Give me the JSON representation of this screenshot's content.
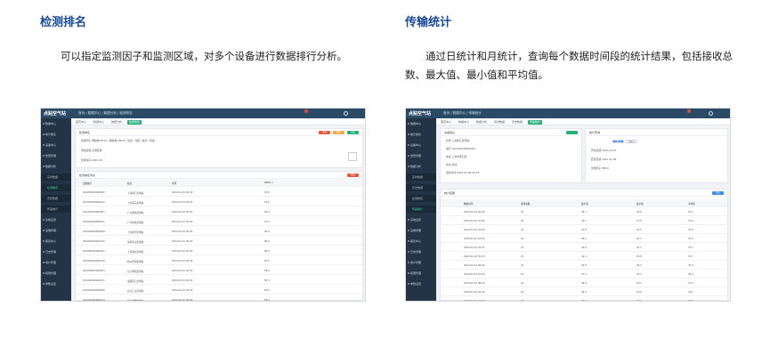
{
  "left": {
    "title": "检测排名",
    "description": "可以指定监测因子和监测区域，对多个设备进行数据排行分析。",
    "shot": {
      "logo": "点贴空气站",
      "breadcrumb": "首页 / 数据中心 / 数据分析 / 检测排名",
      "tabs": [
        "首页中心",
        "数据中心",
        "数据分析",
        "检测排名"
      ],
      "sidebar": [
        "数据中心",
        "统计报表",
        "设备中心",
        "告警管理",
        "数据分析",
        "实时数据",
        "检测排名",
        "历史数据",
        "传输统计",
        "系统设置",
        "运维管理",
        "报表中心",
        "日志管理",
        "用户管理",
        "权限管理",
        "参数设置"
      ],
      "filter_title": "检测排名",
      "filter_rows": [
        "监测因子  颗粒物 PM10 / 颗粒物 PM2.5 / 温度 / 湿度 / 噪声 / 风速",
        "所属区域  全部区域",
        "监测时间  2022-05"
      ],
      "buttons": [
        {
          "label": "查询",
          "color": "#e9573f"
        },
        {
          "label": "重置",
          "color": "#f0ad4e"
        },
        {
          "label": "导出",
          "color": "#27b07a"
        }
      ],
      "table_title": "检测排名列表",
      "table_btn": "导出",
      "columns": [
        "设备编号",
        "站点",
        "时间",
        "PM10 ↓"
      ],
      "rows": [
        [
          "202206040060003",
          "上海徐汇监测站",
          "2022-02-01 00:00",
          "95.0"
        ],
        [
          "202206040060012",
          "上海浦东监测站",
          "2022-02-01 00:00",
          "93.0"
        ],
        [
          "202206040060007",
          "广州番禺监测站",
          "2022-02-01 00:00",
          "92.0"
        ],
        [
          "202206040060021",
          "广州越秀监测站",
          "2022-02-01 00:00",
          "91.0"
        ],
        [
          "202206040060009",
          "上海闵行监测站",
          "2022-02-01 00:00",
          "90.0"
        ],
        [
          "202206040060015",
          "深圳南山监测站",
          "2022-02-01 00:00",
          "89.0"
        ],
        [
          "202206040060002",
          "上海静安监测站",
          "2022-02-01 00:00",
          "88.0"
        ],
        [
          "202206040060018",
          "杭州西湖监测站",
          "2022-02-01 00:00",
          "87.0"
        ],
        [
          "202206040060004",
          "北京朝阳监测站",
          "2022-02-01 00:00",
          "86.0"
        ],
        [
          "202206040060011",
          "成都锦江监测站",
          "2022-02-01 00:00",
          "85.0"
        ],
        [
          "202206040060006",
          "武汉江汉监测站",
          "2022-02-01 00:00",
          "84.0"
        ],
        [
          "202206040060013",
          "南京鼓楼监测站",
          "2022-02-01 00:00",
          "83.0"
        ]
      ]
    }
  },
  "right": {
    "title": "传输统计",
    "description": "通过日统计和月统计，查询每个数据时间段的统计结果，包括接收总数、最大值、最小值和平均值。",
    "shot": {
      "logo": "点贴空气站",
      "breadcrumb": "首页 / 数据中心 / 传输统计",
      "tabs": [
        "首页中心",
        "数据中心",
        "数据分析",
        "实时数据",
        "历史数据",
        "传输统计"
      ],
      "sidebar": [
        "数据中心",
        "统计报表",
        "设备中心",
        "告警管理",
        "数据分析",
        "实时数据",
        "历史数据",
        "检测排名",
        "传输统计",
        "系统设置",
        "运维管理",
        "报表中心",
        "日志管理",
        "用户管理",
        "权限管理",
        "参数设置"
      ],
      "info_title": "设备信息",
      "info_rows": [
        "名称  上海徐汇监测站",
        "编号  202206040060003",
        "地址  上海市徐汇区",
        "状态  在线",
        "更新时间  2022-02-06 09:19"
      ],
      "query_title": "统计查询",
      "query_tabs": [
        "日统计",
        "月统计"
      ],
      "query_rows": [
        "开始日期  2022-02-01",
        "结束日期  2022-02-06",
        "监测因子  PM10"
      ],
      "result_title": "统计结果",
      "result_btn": "导出",
      "columns": [
        "数据时间",
        "接收总数",
        "最大值",
        "最小值",
        "平均值"
      ],
      "rows": [
        [
          "2022-02-01 00:00",
          "24",
          "45.3",
          "28.6",
          "35.2"
        ],
        [
          "2022-02-01 01:00",
          "24",
          "43.1",
          "27.9",
          "34.6"
        ],
        [
          "2022-02-01 02:00",
          "24",
          "41.8",
          "26.5",
          "33.9"
        ],
        [
          "2022-02-01 03:00",
          "24",
          "40.2",
          "25.7",
          "32.8"
        ],
        [
          "2022-02-01 04:00",
          "24",
          "39.6",
          "25.1",
          "32.1"
        ],
        [
          "2022-02-01 05:00",
          "24",
          "42.4",
          "26.8",
          "33.7"
        ],
        [
          "2022-02-01 06:00",
          "24",
          "44.9",
          "28.2",
          "35.0"
        ],
        [
          "2022-02-01 07:00",
          "24",
          "47.3",
          "29.4",
          "36.4"
        ],
        [
          "2022-02-01 08:00",
          "24",
          "48.8",
          "30.1",
          "37.2"
        ],
        [
          "2022-02-01 09:00",
          "24",
          "46.5",
          "29.0",
          "36.1"
        ],
        [
          "2022-02-01 10:00",
          "24",
          "45.0",
          "28.3",
          "35.5"
        ]
      ]
    }
  }
}
